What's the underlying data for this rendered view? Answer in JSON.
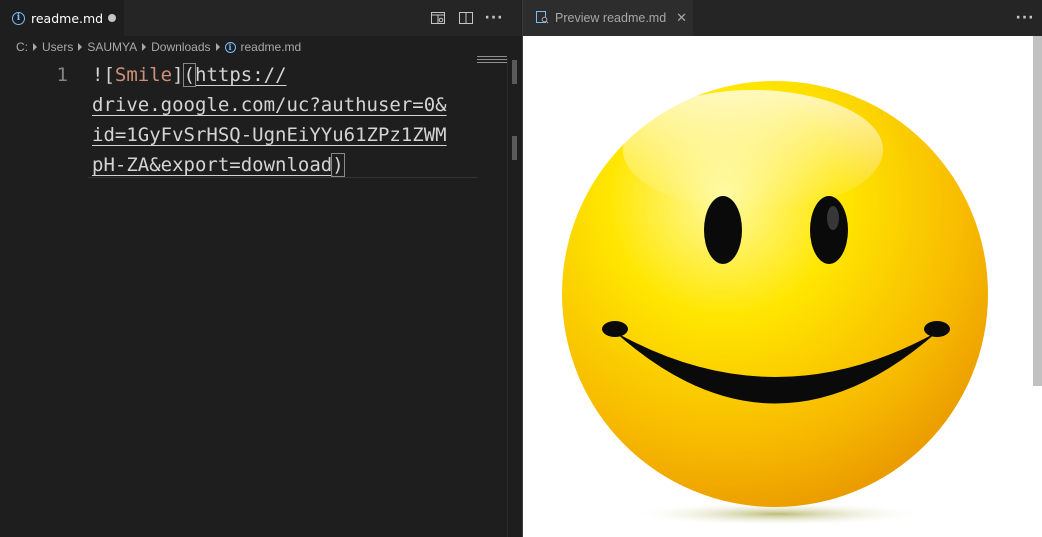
{
  "editor": {
    "tab": {
      "label": "readme.md",
      "icon": "info-icon",
      "dirty": true
    },
    "actions": [
      "open-preview-side-icon",
      "split-editor-icon",
      "more-actions-icon"
    ],
    "breadcrumb": [
      "C:",
      "Users",
      "SAUMYA",
      "Downloads",
      "readme.md"
    ],
    "line_number": "1",
    "code": {
      "prefix": "![",
      "alt": "Smile",
      "mid": "](",
      "url_line1": "https://",
      "url_line2": "drive.google.com/uc?authuser=0&",
      "url_line3": "id=1GyFvSrHSQ-UgnEiYYu61ZPz1ZWM",
      "url_line4": "pH-ZA&export=download",
      "suffix": ")"
    },
    "more_symbol": "···"
  },
  "preview": {
    "tab": {
      "label": "Preview readme.md",
      "icon": "preview-icon",
      "close": "✕"
    },
    "more_symbol": "···",
    "image": {
      "alt": "Smile",
      "face_color": "#f7c400",
      "feature_color": "#000000"
    }
  },
  "colors": {
    "editor_bg": "#1e1e1e",
    "tabbar_bg": "#252526",
    "alt_text": "#ce9178",
    "info_blue": "#75beff"
  }
}
